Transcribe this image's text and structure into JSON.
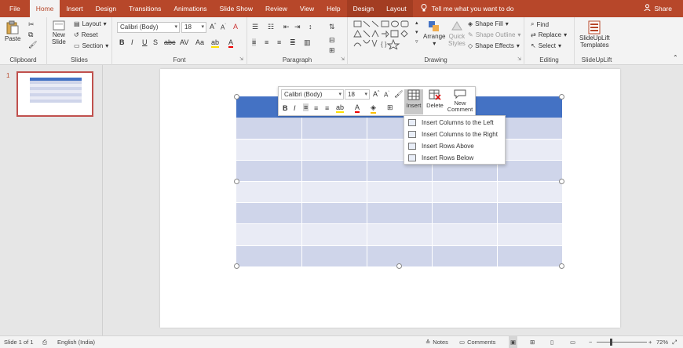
{
  "tabs": [
    "File",
    "Home",
    "Insert",
    "Design",
    "Transitions",
    "Animations",
    "Slide Show",
    "Review",
    "View",
    "Help"
  ],
  "active_tab": "Home",
  "context_tabs": [
    "Design",
    "Layout"
  ],
  "tell_me": "Tell me what you want to do",
  "share": "Share",
  "ribbon": {
    "clipboard": {
      "paste": "Paste",
      "label": "Clipboard"
    },
    "slides": {
      "new_slide_1": "New",
      "new_slide_2": "Slide",
      "layout": "Layout",
      "reset": "Reset",
      "section": "Section",
      "label": "Slides"
    },
    "font": {
      "font_name": "Calibri (Body)",
      "font_size": "18",
      "label": "Font"
    },
    "paragraph": {
      "label": "Paragraph"
    },
    "drawing": {
      "arrange": "Arrange",
      "quick_1": "Quick",
      "quick_2": "Styles",
      "shape_fill": "Shape Fill",
      "shape_outline": "Shape Outline",
      "shape_effects": "Shape Effects",
      "label": "Drawing"
    },
    "editing": {
      "find": "Find",
      "replace": "Replace",
      "select": "Select",
      "label": "Editing"
    },
    "slideuplift": {
      "line1": "SlideUpLift",
      "line2": "Templates",
      "label": "SlideUpLift"
    }
  },
  "slide_number": "1",
  "mini_toolbar": {
    "font_name": "Calibri (Body)",
    "font_size": "18",
    "insert": "Insert",
    "delete": "Delete",
    "new_comment_1": "New",
    "new_comment_2": "Comment"
  },
  "insert_menu": [
    "Insert Columns to the Left",
    "Insert Columns to the Right",
    "Insert Rows Above",
    "Insert Rows Below"
  ],
  "status": {
    "slide": "Slide 1 of 1",
    "language": "English (India)",
    "notes": "Notes",
    "comments": "Comments",
    "zoom": "72%"
  },
  "colors": {
    "accent": "#b7472a",
    "table_header": "#4472c4",
    "row_dark": "#cfd5ea",
    "row_light": "#e9ebf5"
  }
}
